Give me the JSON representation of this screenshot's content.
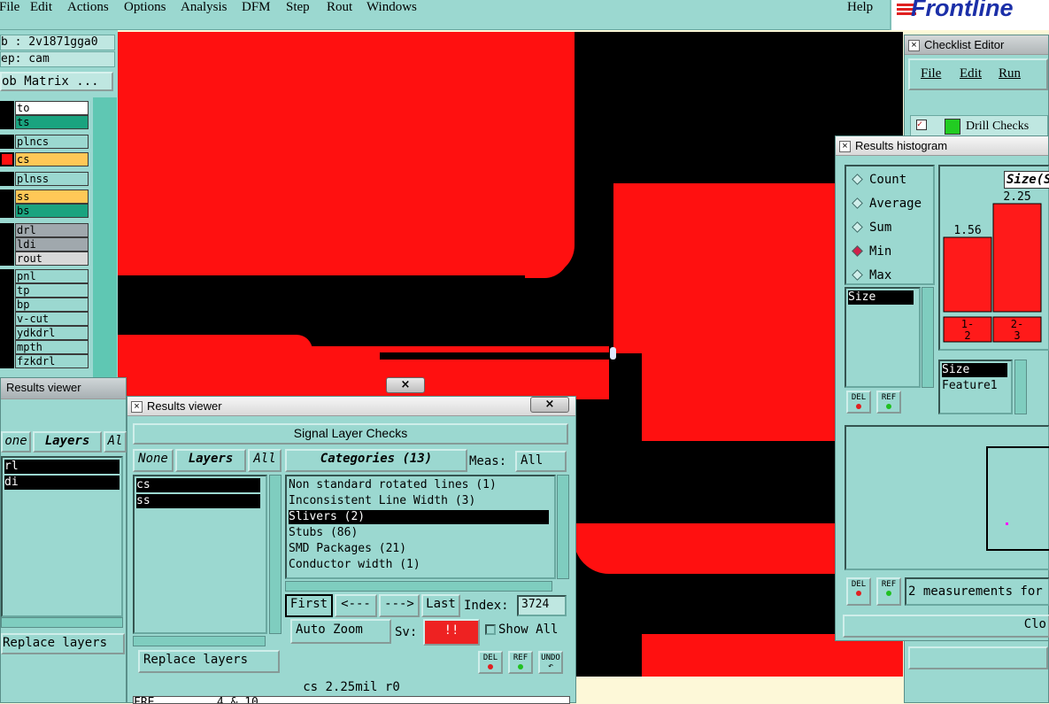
{
  "menubar": {
    "items": [
      "File",
      "Edit",
      "Actions",
      "Options",
      "Analysis",
      "DFM",
      "Step",
      "Rout",
      "Windows"
    ],
    "help": "Help"
  },
  "logo": {
    "text": "Frontline"
  },
  "job_panel": {
    "job_line": "b : 2v1871gga0",
    "step_line": "ep: cam",
    "matrix_button": "ob Matrix ...",
    "layers": [
      {
        "name": "to",
        "color": "#ffffff"
      },
      {
        "name": "ts",
        "color": "#1aa37f"
      },
      {
        "name": "plncs",
        "color": "#9bd8d0"
      },
      {
        "name": "cs",
        "color": "#ffc857"
      },
      {
        "name": "plnss",
        "color": "#9bd8d0"
      },
      {
        "name": "ss",
        "color": "#ffc857"
      },
      {
        "name": "bs",
        "color": "#1aa37f"
      },
      {
        "name": "drl",
        "color": "#a0a8ad"
      },
      {
        "name": "ldi",
        "color": "#a0a8ad"
      },
      {
        "name": "rout",
        "color": "#d8d8d8"
      },
      {
        "name": "pnl",
        "color": "#9bd8d0"
      },
      {
        "name": "tp",
        "color": "#9bd8d0"
      },
      {
        "name": "bp",
        "color": "#9bd8d0"
      },
      {
        "name": "v-cut",
        "color": "#9bd8d0"
      },
      {
        "name": "ydkdrl",
        "color": "#9bd8d0"
      },
      {
        "name": "mpth",
        "color": "#9bd8d0"
      },
      {
        "name": "fzkdrl",
        "color": "#9bd8d0"
      }
    ]
  },
  "results_viewer_back": {
    "title": "Results viewer",
    "close": "×",
    "none_btn": "one",
    "layers_btn": "Layers",
    "all_btn": "Al",
    "rows": [
      "rl",
      "di"
    ],
    "replace": "Replace layers"
  },
  "results_viewer": {
    "title": "Results viewer",
    "close": "×",
    "header": "Signal Layer Checks",
    "none_btn": "None",
    "layers_btn": "Layers",
    "all_btn": "All",
    "layers": [
      "cs",
      "ss"
    ],
    "categories_btn": "Categories (13)",
    "meas_label": "Meas:",
    "meas_value": "All",
    "categories": [
      "Non standard rotated lines (1)",
      "Inconsistent Line Width (3)",
      "Slivers (2)",
      "Stubs (86)",
      "SMD Packages (21)",
      "Conductor width (1)"
    ],
    "selected_category": 2,
    "nav": {
      "first": "First",
      "prev": "<---",
      "next": "--->",
      "last": "Last"
    },
    "index_label": "Index:",
    "index_value": "3724",
    "zoom_mode": "Auto Zoom",
    "sv_label": "Sv:",
    "sv_value": "!!",
    "show_all": "Show All",
    "replace": "Replace layers",
    "del": "DEL",
    "ref": "REF",
    "undo": "UNDO",
    "status": "cs 2.25mil  r0",
    "bottom_text": "FRE .  .  .  .  4 & 10"
  },
  "checklist_editor": {
    "title": "Checklist Editor",
    "menu": [
      "File",
      "Edit",
      "Run"
    ],
    "item": "Drill Checks"
  },
  "results_histogram": {
    "title": "Results histogram",
    "modes": [
      "Count",
      "Average",
      "Sum",
      "Min",
      "Max"
    ],
    "selected_mode": 3,
    "measure_list": [
      "Size"
    ],
    "chart_header": "Size(S",
    "bars": [
      {
        "label": "1.56",
        "range": "1-\n2"
      },
      {
        "label": "2.25",
        "range": "2-\n3"
      }
    ],
    "field_list": [
      "Size",
      "Feature1"
    ],
    "summary": "2 measurements for",
    "close_btn": "Clo",
    "del": "DEL",
    "ref": "REF"
  }
}
